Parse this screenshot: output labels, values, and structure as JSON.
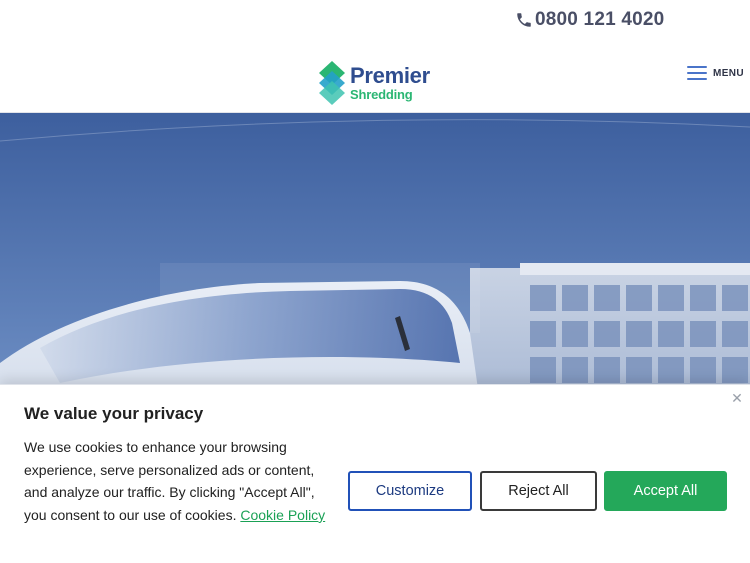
{
  "topbar": {
    "phone_icon": "phone-icon",
    "phone_number": "0800 121 4020"
  },
  "header": {
    "logo_word1": "Premier",
    "logo_word2": "Shredding",
    "menu_icon": "hamburger-menu-icon",
    "menu_label": "MENU"
  },
  "hero": {
    "image_subject": "white van parked outside a modern glass office building under a blue sky"
  },
  "cookie_banner": {
    "close_icon": "close-icon",
    "title": "We value your privacy",
    "body": "We use cookies to enhance your browsing experience, serve personalized ads or content, and analyze our traffic. By clicking \"Accept All\", you consent to our use of cookies.",
    "link_text": "Cookie Policy",
    "buttons": {
      "customize": "Customize",
      "reject": "Reject All",
      "accept": "Accept All"
    }
  },
  "colors": {
    "brand_blue": "#2f4d8f",
    "brand_green": "#2bb673",
    "accept_green": "#24a85a",
    "customize_blue": "#2151b8",
    "phone_text": "#4a4f66"
  }
}
